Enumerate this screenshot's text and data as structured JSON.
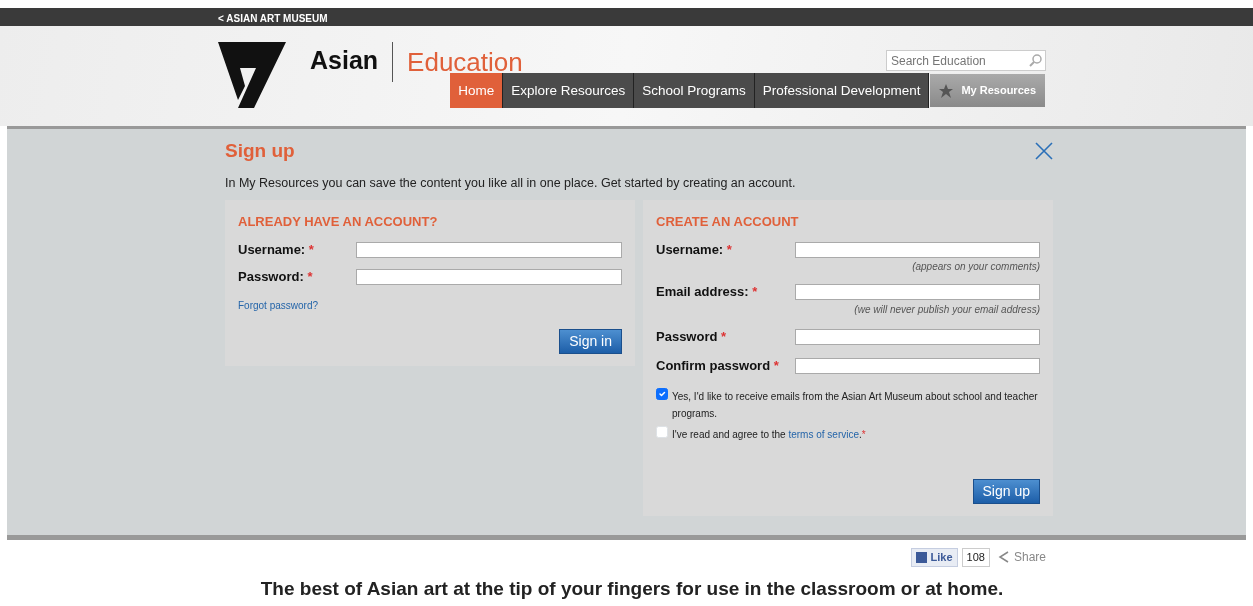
{
  "top_bar": {
    "back_link": "< ASIAN ART MUSEUM"
  },
  "header": {
    "brand": "Asian",
    "section": "Education",
    "search": {
      "placeholder": "Search Education"
    }
  },
  "nav": [
    {
      "label": "Home",
      "selected": true,
      "kind": "tab"
    },
    {
      "label": "Explore Resources",
      "selected": false,
      "kind": "tab"
    },
    {
      "label": "School Programs",
      "selected": false,
      "kind": "tab"
    },
    {
      "label": "Professional Development",
      "selected": false,
      "kind": "tab"
    },
    {
      "label": "My Resources",
      "selected": false,
      "kind": "star-tab"
    }
  ],
  "signup": {
    "title": "Sign up",
    "intro": "In My Resources you can save the content you like all in one place. Get started by creating an account.",
    "login": {
      "heading": "ALREADY HAVE AN ACCOUNT?",
      "fields": [
        {
          "label": "Username:",
          "mark": "*"
        },
        {
          "label": "Password:",
          "mark": "*"
        }
      ],
      "forgot": "Forgot password?",
      "button": "Sign in"
    },
    "create": {
      "heading": "CREATE AN ACCOUNT",
      "fields": [
        {
          "label": "Username:",
          "mark": "*",
          "hint": "(appears on your comments)"
        },
        {
          "label": "Email address:",
          "mark": "*",
          "hint": "(we will never publish your email address)"
        },
        {
          "label": "Password",
          "mark": "*"
        },
        {
          "label": "Confirm password",
          "mark": "*"
        }
      ],
      "checks": [
        {
          "text": "Yes, I'd like to receive emails from the Asian Art Museum about school and teacher programs.",
          "checked": true
        },
        {
          "text": "I've read and agree to the ",
          "link": "terms of service",
          "after": ".",
          "mark": "*",
          "checked": false
        }
      ],
      "button": "Sign up"
    }
  },
  "social": {
    "like": "Like",
    "count": "108",
    "share": "Share"
  },
  "tagline": "The best of Asian art at the tip of your fingers for use in the classroom or at home."
}
